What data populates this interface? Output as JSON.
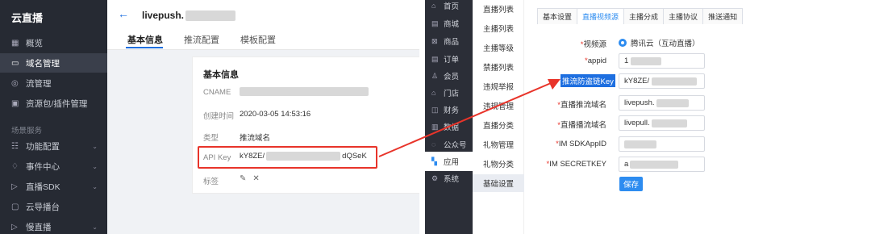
{
  "left_app": {
    "title": "云直播",
    "menu": [
      {
        "label": "概览",
        "icon": "grid-icon"
      },
      {
        "label": "域名管理",
        "icon": "monitor-icon"
      },
      {
        "label": "流管理",
        "icon": "stream-icon"
      },
      {
        "label": "资源包/插件管理",
        "icon": "package-icon"
      }
    ],
    "group_label": "场景服务",
    "group_menu": [
      {
        "label": "功能配置",
        "icon": "sliders-icon"
      },
      {
        "label": "事件中心",
        "icon": "bell-icon"
      },
      {
        "label": "直播SDK",
        "icon": "play-icon"
      },
      {
        "label": "云导播台",
        "icon": "broadcast-icon"
      },
      {
        "label": "慢直播",
        "icon": "slow-live-icon"
      }
    ],
    "header": {
      "back": "←",
      "title": "livepush."
    },
    "tabs": [
      "基本信息",
      "推流配置",
      "模板配置"
    ],
    "card": {
      "title": "基本信息",
      "rows": [
        {
          "label": "CNAME",
          "value": ""
        },
        {
          "label": "创建时间",
          "value": "2020-03-05 14:53:16"
        },
        {
          "label": "类型",
          "value": "推流域名"
        },
        {
          "label": "API Key",
          "value": "kY8ZE/",
          "value_end": "dQSeK"
        },
        {
          "label": "标签",
          "value": ""
        }
      ]
    }
  },
  "mid_app": {
    "menu": [
      {
        "label": "首页",
        "icon": "home-icon"
      },
      {
        "label": "商城",
        "icon": "shop-icon"
      },
      {
        "label": "商品",
        "icon": "goods-icon"
      },
      {
        "label": "订单",
        "icon": "order-icon"
      },
      {
        "label": "会员",
        "icon": "user-icon"
      },
      {
        "label": "门店",
        "icon": "store-icon"
      },
      {
        "label": "财务",
        "icon": "finance-icon"
      },
      {
        "label": "数据",
        "icon": "chart-icon"
      },
      {
        "label": "公众号",
        "icon": "wechat-icon"
      },
      {
        "label": "应用",
        "icon": "apps-icon"
      },
      {
        "label": "系统",
        "icon": "settings-icon"
      }
    ],
    "submenu": [
      "直播列表",
      "主播列表",
      "主播等级",
      "禁播列表",
      "违规举报",
      "违规管理",
      "直播分类",
      "礼物管理",
      "礼物分类",
      "基础设置"
    ]
  },
  "right_app": {
    "tabs": [
      "基本设置",
      "直播视频源",
      "主播分成",
      "主播协议",
      "推送通知"
    ],
    "form": {
      "video_source_label": "视频源",
      "video_source_value": "腾讯云（互动直播）",
      "appid_label": "appid",
      "appid_value": "1",
      "key_label": "推流防盗链Key",
      "key_value": "kY8ZE/",
      "push_domain_label": "直播推流域名",
      "push_domain_value": "livepush.",
      "pull_domain_label": "直播播流域名",
      "pull_domain_value": "livepull.",
      "im_appid_label": "IM SDKAppID",
      "im_appid_value": "",
      "im_secret_label": "IM SECRETKEY",
      "im_secret_value": "a",
      "save_label": "保存"
    }
  },
  "colors": {
    "accent": "#2d8cf0",
    "highlight": "#e8342a",
    "sidebar_dark": "#262a33"
  }
}
